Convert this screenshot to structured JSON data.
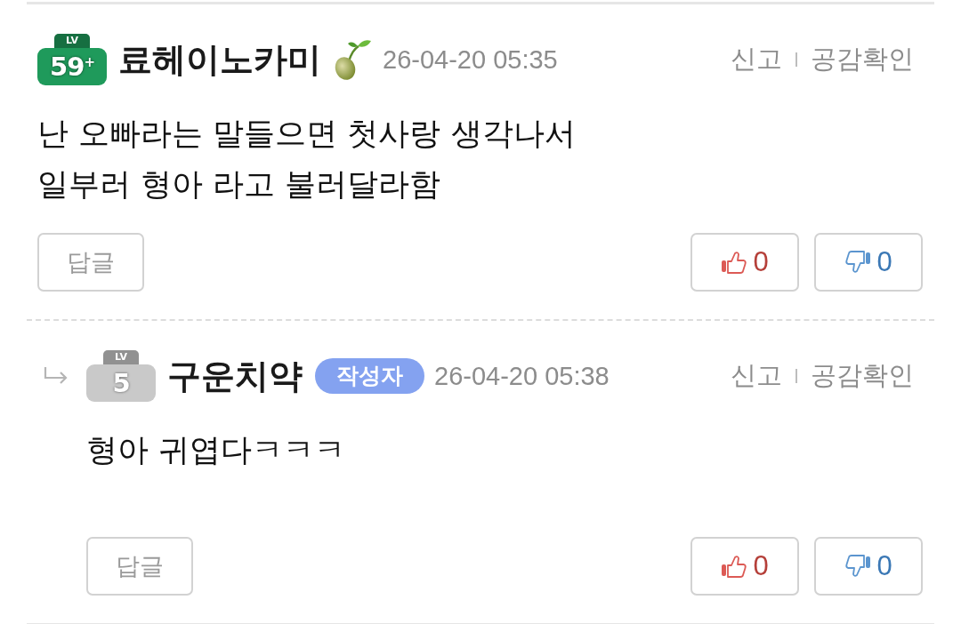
{
  "comments": [
    {
      "kind": "comment",
      "level_badge": {
        "caption": "LV",
        "number": "59$^{+}$",
        "color": "#1f9a5b"
      },
      "nickname": "료헤이노카미",
      "sprout_mark": true,
      "timestamp": "26-04-20 05:35",
      "actions": [
        "신고",
        "공감확인"
      ],
      "body": "난 오빠라는 말들으면 첫사랑 생각나서\n일부러 형아 라고 불러달라함",
      "reply_button": "답글",
      "likes": "0",
      "dislikes": "0"
    },
    {
      "kind": "reply",
      "level_badge": {
        "caption": "LV",
        "number": "5",
        "color": "#c9c9c9"
      },
      "nickname": "구운치약",
      "sprout_mark": false,
      "author_tag": "작성자",
      "timestamp": "26-04-20 05:38",
      "actions": [
        "신고",
        "공감확인"
      ],
      "body": "형아 귀엽다ㅋㅋㅋ",
      "reply_button": "답글",
      "likes": "0",
      "dislikes": "0"
    }
  ]
}
